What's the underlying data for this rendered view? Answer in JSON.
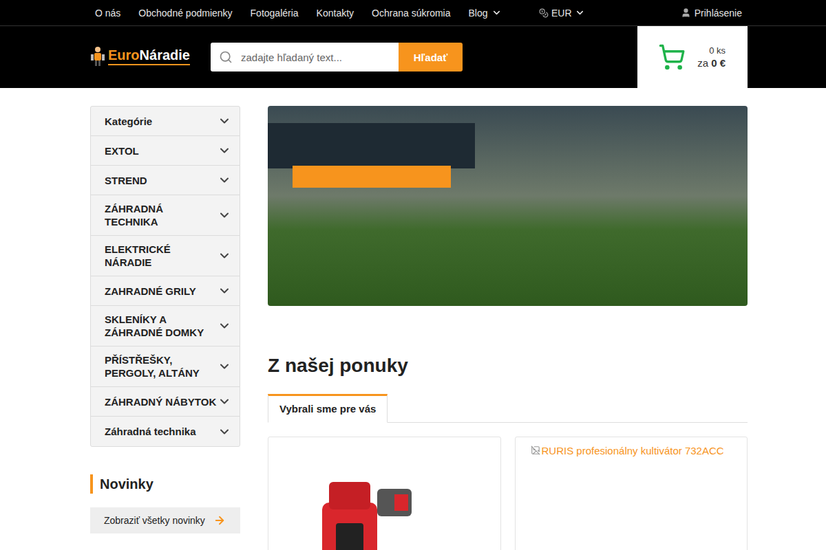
{
  "topbar": {
    "links": [
      {
        "label": "O nás",
        "dropdown": false
      },
      {
        "label": "Obchodné podmienky",
        "dropdown": false
      },
      {
        "label": "Fotogaléria",
        "dropdown": false
      },
      {
        "label": "Kontakty",
        "dropdown": false
      },
      {
        "label": "Ochrana súkromia",
        "dropdown": false
      },
      {
        "label": "Blog",
        "dropdown": true
      }
    ],
    "currency": "EUR",
    "login": "Prihlásenie"
  },
  "logo": {
    "part1": "Euro",
    "part2": "Náradie"
  },
  "search": {
    "placeholder": "zadajte hľadaný text...",
    "button": "Hľadať"
  },
  "cart": {
    "count": "0 ks",
    "total_prefix": "za",
    "total": "0 €"
  },
  "sidebar": {
    "items": [
      {
        "label": "Kategórie",
        "expanded": false
      },
      {
        "label": "EXTOL",
        "expanded": false
      },
      {
        "label": "STREND",
        "expanded": false
      },
      {
        "label": "ZÁHRADNÁ TECHNIKA",
        "expanded": false
      },
      {
        "label": "ELEKTRICKÉ NÁRADIE",
        "expanded": false
      },
      {
        "label": "ZAHRADNÉ GRILY",
        "expanded": false
      },
      {
        "label": "SKLENÍKY A ZÁHRADNÉ DOMKY",
        "expanded": false
      },
      {
        "label": "PŘÍSTŘEŠKY, PERGOLY, ALTÁNY",
        "expanded": false
      },
      {
        "label": "ZÁHRADNÝ NÁBYTOK",
        "expanded": false
      },
      {
        "label": "Záhradná technika",
        "expanded": false
      }
    ]
  },
  "news": {
    "title": "Novinky",
    "link": "Zobraziť všetky novinky"
  },
  "section": {
    "title": "Z našej ponuky",
    "tabs": [
      {
        "label": "Vybrali sme pre vás",
        "selected": true
      }
    ]
  },
  "products": [
    {
      "kind": "image",
      "alt": ""
    },
    {
      "kind": "broken-image",
      "alt": "RURIS profesionálny kultivátor 732ACC"
    }
  ]
}
